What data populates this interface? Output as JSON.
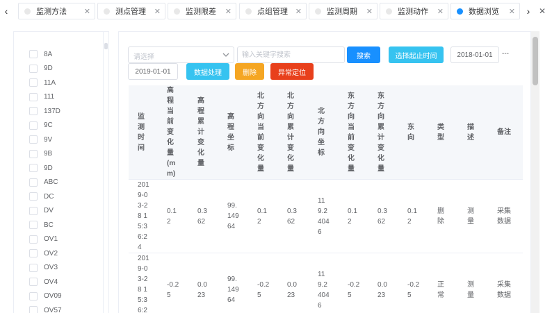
{
  "tabs": [
    {
      "label": "监测方法",
      "active": false
    },
    {
      "label": "测点管理",
      "active": false
    },
    {
      "label": "监测限差",
      "active": false
    },
    {
      "label": "点组管理",
      "active": false
    },
    {
      "label": "监测周期",
      "active": false
    },
    {
      "label": "监测动作",
      "active": false
    },
    {
      "label": "数据浏览",
      "active": true
    }
  ],
  "tab_close_glyph": "✕",
  "nav": {
    "left": "‹",
    "right": "›",
    "close_all": "✕"
  },
  "tree_items": [
    "8A",
    "9D",
    "11A",
    "111",
    "137D",
    "9C",
    "9V",
    "9B",
    "9D",
    "ABC",
    "DC",
    "DV",
    "BC",
    "OV1",
    "OV2",
    "OV3",
    "OV4",
    "OV09",
    "OV57"
  ],
  "toolbar": {
    "select_placeholder": "请选择",
    "keyword_placeholder": "输入关键字搜索",
    "search_label": "搜索",
    "range_label": "选择起止时间",
    "date_start": "2018-01-01",
    "date_sep": "---",
    "date_end": "2019-01-01",
    "process_label": "数据处理",
    "delete_label": "删除",
    "locate_label": "异常定位"
  },
  "table": {
    "headers": [
      "监测时间",
      "高程当前变化量(mm)",
      "高程累计变化量",
      "高程坐标",
      "北方向当前变化量",
      "北方向累计变化量",
      "北方向坐标",
      "东方向当前变化量",
      "东方向累计变化量",
      "东向",
      "类型",
      "描述",
      "备注"
    ],
    "rows": [
      [
        "2019-03-28 15:36:24",
        "0.12",
        "0.362",
        "99.14964",
        "0.12",
        "0.362",
        "119.24046",
        "0.12",
        "0.362",
        "0.12",
        "删除",
        "测量",
        "采集数据"
      ],
      [
        "2019-03-28 15:36:24",
        "-0.25",
        "0.023",
        "99.14964",
        "-0.25",
        "0.023",
        "119.24046",
        "-0.25",
        "0.023",
        "-0.25",
        "正常",
        "测量",
        "采集数据"
      ]
    ]
  },
  "colors": {
    "primary": "#1890ff",
    "info": "#36c3f0",
    "warning": "#f5a623",
    "danger": "#e8401c"
  }
}
